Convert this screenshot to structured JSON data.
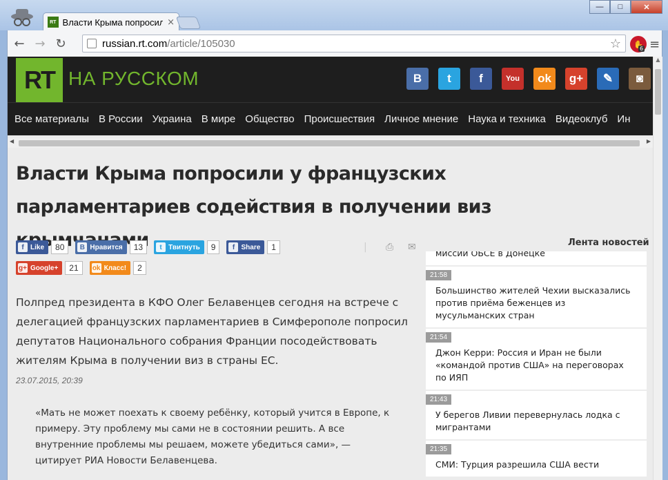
{
  "browser": {
    "tab_title": "Власти Крыма попросили",
    "tab_close": "×",
    "url_host": "russian.rt.com",
    "url_path": "/article/105030",
    "ext_badge": "6",
    "win_min": "—",
    "win_max": "□",
    "win_close": "✕"
  },
  "site": {
    "logo": "RT",
    "subtitle": "НА РУССКОМ",
    "socials": [
      {
        "name": "vk",
        "glyph": "B",
        "color": "#4a6ea8"
      },
      {
        "name": "twitter",
        "glyph": "t",
        "color": "#2aa4e0"
      },
      {
        "name": "facebook",
        "glyph": "f",
        "color": "#3b5998"
      },
      {
        "name": "youtube",
        "glyph": "You",
        "color": "#c4302b"
      },
      {
        "name": "odnoklassniki",
        "glyph": "ok",
        "color": "#f28a1b"
      },
      {
        "name": "googleplus",
        "glyph": "g+",
        "color": "#d6422c"
      },
      {
        "name": "livejournal",
        "glyph": "✎",
        "color": "#2a6bb7"
      },
      {
        "name": "instagram",
        "glyph": "◙",
        "color": "#7b5b3d"
      }
    ],
    "nav": [
      "Все материалы",
      "В России",
      "Украина",
      "В мире",
      "Общество",
      "Происшествия",
      "Личное мнение",
      "Наука и техника",
      "Видеоклуб",
      "Ин"
    ]
  },
  "article": {
    "title": "Власти Крыма попросили у французских парламентариев содействия в получении виз крымчанами",
    "share": [
      {
        "label": "Like",
        "count": "80",
        "glyph": "f",
        "color": "#3b5998"
      },
      {
        "label": "Нравится",
        "count": "13",
        "glyph": "B",
        "color": "#4a6ea8"
      },
      {
        "label": "Твитнуть",
        "count": "9",
        "glyph": "t",
        "color": "#2aa4e0"
      },
      {
        "label": "Share",
        "count": "1",
        "glyph": "f",
        "color": "#3b5998"
      }
    ],
    "share2": [
      {
        "label": "Google+",
        "count": "21",
        "glyph": "g+",
        "color": "#d6422c"
      },
      {
        "label": "Класс!",
        "count": "2",
        "glyph": "ok",
        "color": "#f28a1b"
      }
    ],
    "lead": "Полпред президента в КФО Олег Белавенцев сегодня на встрече с делегацией французских парламентариев в Симферополе попросил депутатов Национального собрания Франции посодействовать жителям Крыма в получении виз в страны ЕС.",
    "date": "23.07.2015, 20:39",
    "quote": "«Мать не может поехать к своему ребёнку, который учится в Европе, к примеру. Эту проблему мы сами не в состоянии решить. А все внутренние проблемы мы решаем, можете убедиться сами», — цитирует РИА Новости Белавенцева."
  },
  "feed": {
    "title": "Лента новостей",
    "partial_text": "миссии ОБСЕ в Донецке",
    "items": [
      {
        "time": "21:58",
        "text": "Большинство жителей Чехии высказались против приёма беженцев из мусульманских стран"
      },
      {
        "time": "21:54",
        "text": "Джон Керри: Россия и Иран не были «командой против США» на переговорах по ИЯП"
      },
      {
        "time": "21:43",
        "text": "У берегов Ливии перевернулась лодка с мигрантами"
      },
      {
        "time": "21:35",
        "text": "СМИ: Турция разрешила США вести"
      }
    ]
  }
}
